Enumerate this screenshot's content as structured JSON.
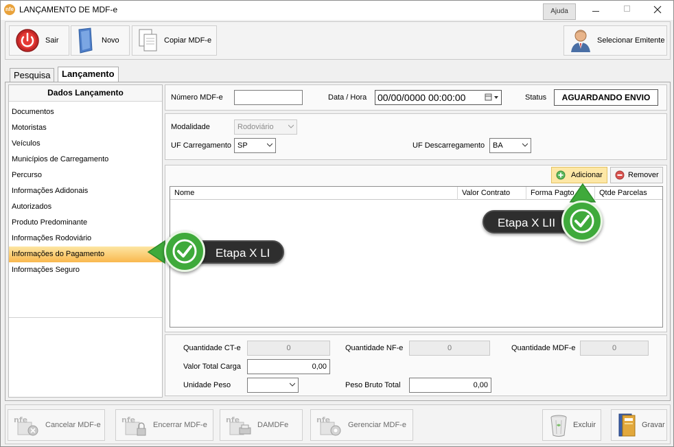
{
  "window": {
    "title": "LANÇAMENTO DE MDF-e",
    "help_label": "Ajuda"
  },
  "toolbar": {
    "sair": "Sair",
    "novo": "Novo",
    "copiar": "Copiar MDF-e",
    "selecionar_emitente": "Selecionar Emitente"
  },
  "tabs": [
    {
      "label": "Pesquisa"
    },
    {
      "label": "Lançamento"
    }
  ],
  "sidebar": {
    "title": "Dados Lançamento",
    "items": [
      {
        "label": "Documentos"
      },
      {
        "label": "Motoristas"
      },
      {
        "label": "Veículos"
      },
      {
        "label": "Municípios de Carregamento"
      },
      {
        "label": "Percurso"
      },
      {
        "label": "Informações Adidonais"
      },
      {
        "label": "Autorizados"
      },
      {
        "label": "Produto Predominante"
      },
      {
        "label": "Informações Rodoviário"
      },
      {
        "label": "Informações do Pagamento"
      },
      {
        "label": "Informações Seguro"
      }
    ]
  },
  "header": {
    "numero_label": "Número MDF-e",
    "numero_value": "",
    "data_label": "Data / Hora",
    "data_value": "00/00/0000 00:00:00",
    "status_label": "Status",
    "status_value": "AGUARDANDO ENVIO"
  },
  "transport": {
    "modalidade_label": "Modalidade",
    "modalidade_value": "Rodoviário",
    "uf_carregamento_label": "UF Carregamento",
    "uf_carregamento_value": "SP",
    "uf_descarregamento_label": "UF Descarregamento",
    "uf_descarregamento_value": "BA"
  },
  "payments": {
    "add_label": "Adicionar",
    "remove_label": "Remover",
    "columns": [
      "Nome",
      "Valor Contrato",
      "Forma Pagto",
      "Qtde Parcelas"
    ]
  },
  "totals": {
    "qtd_cte_label": "Quantidade CT-e",
    "qtd_cte_value": "0",
    "qtd_nfe_label": "Quantidade NF-e",
    "qtd_nfe_value": "0",
    "qtd_mdfe_label": "Quantidade MDF-e",
    "qtd_mdfe_value": "0",
    "valor_total_label": "Valor Total Carga",
    "valor_total_value": "0,00",
    "unidade_peso_label": "Unidade Peso",
    "unidade_peso_value": "",
    "peso_bruto_label": "Peso Bruto Total",
    "peso_bruto_value": "0,00"
  },
  "bottom_toolbar": {
    "cancelar": "Cancelar MDF-e",
    "encerrar": "Encerrar MDF-e",
    "damdfe": "DAMDFe",
    "gerenciar": "Gerenciar MDF-e",
    "excluir": "Excluir",
    "gravar": "Gravar"
  },
  "callouts": {
    "step1": "Etapa X LI",
    "step2": "Etapa X LII"
  },
  "colors": {
    "highlight_top": "#fde6a3",
    "highlight_bottom": "#f9b84e",
    "callout_bg": "#2e2e2e",
    "check_green": "#3faa3b"
  }
}
